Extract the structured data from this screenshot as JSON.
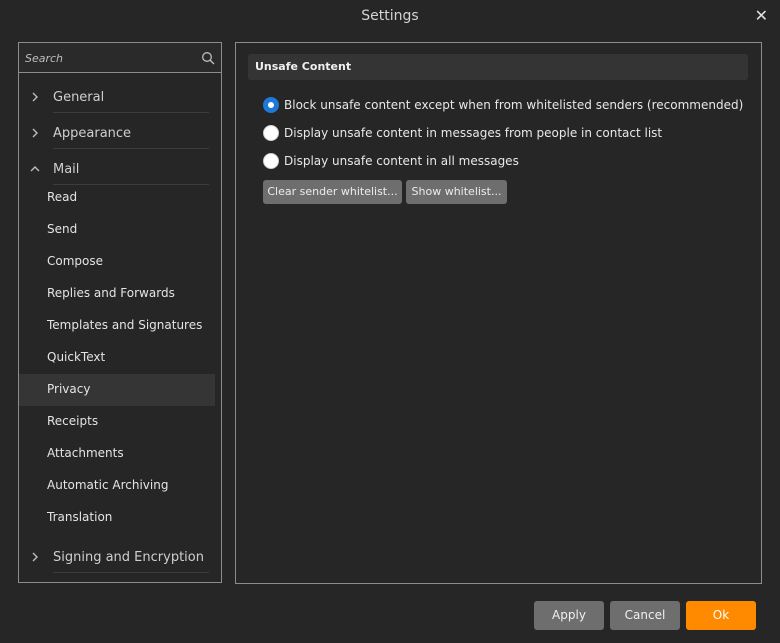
{
  "window": {
    "title": "Settings",
    "close_glyph": "✕"
  },
  "sidebar": {
    "search_placeholder": "Search",
    "categories": [
      {
        "label": "General",
        "icon": "chevron-right-icon"
      },
      {
        "label": "Appearance",
        "icon": "chevron-right-icon"
      },
      {
        "label": "Mail",
        "icon": "chevron-up-icon"
      },
      {
        "label": "Signing and Encryption",
        "icon": "chevron-right-icon"
      }
    ],
    "mail_items": [
      {
        "label": "Read"
      },
      {
        "label": "Send"
      },
      {
        "label": "Compose"
      },
      {
        "label": "Replies and Forwards"
      },
      {
        "label": "Templates and Signatures"
      },
      {
        "label": "QuickText"
      },
      {
        "label": "Privacy",
        "selected": true
      },
      {
        "label": "Receipts"
      },
      {
        "label": "Attachments"
      },
      {
        "label": "Automatic Archiving"
      },
      {
        "label": "Translation"
      }
    ]
  },
  "panel": {
    "section_title": "Unsafe Content",
    "options": [
      {
        "label": "Block unsafe content except when from whitelisted senders (recommended)",
        "checked": true
      },
      {
        "label": "Display unsafe content in messages from people in contact list",
        "checked": false
      },
      {
        "label": "Display unsafe content in all messages",
        "checked": false
      }
    ],
    "buttons": {
      "clear_whitelist": "Clear sender whitelist...",
      "show_whitelist": "Show whitelist..."
    }
  },
  "footer": {
    "apply": "Apply",
    "cancel": "Cancel",
    "ok": "Ok"
  },
  "colors": {
    "background": "#262626",
    "accent_orange": "#ff8a00",
    "radio_selected": "#1e78d7",
    "button_gray": "#6e6e6e"
  }
}
